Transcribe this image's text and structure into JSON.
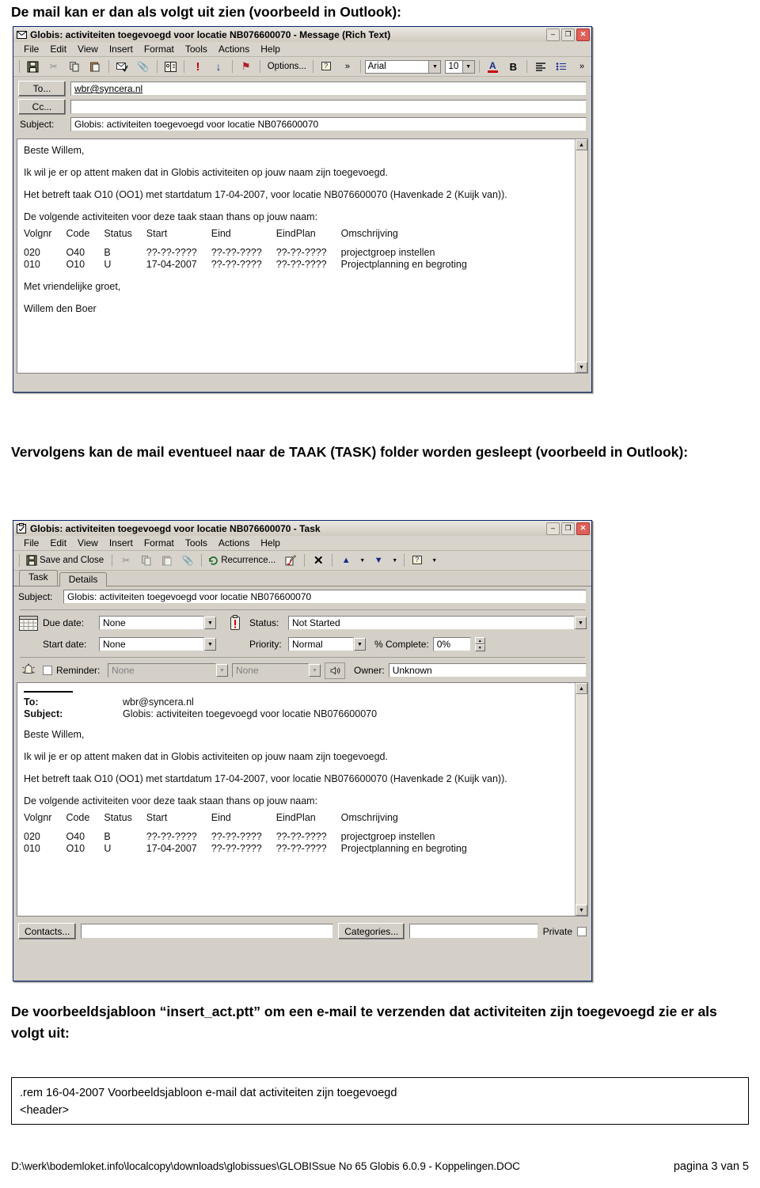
{
  "document": {
    "intro_paragraph": "De mail kan er dan als volgt uit zien (voorbeeld in Outlook):",
    "middle_paragraph": "Vervolgens kan de mail eventueel naar de TAAK (TASK) folder worden gesleept (voorbeeld in Outlook):",
    "template_paragraph": "De voorbeeldsjabloon “insert_act.ptt” om een e-mail te verzenden dat activiteiten zijn toegevoegd zie er als volgt uit:"
  },
  "template_box": {
    "line1": ".rem 16-04-2007 Voorbeeldsjabloon e-mail dat activiteiten zijn toegevoegd",
    "line2": "<header>"
  },
  "footer": {
    "path": "D:\\werk\\bodemloket.info\\localcopy\\downloads\\globissues\\GLOBISsue No 65 Globis 6.0.9 - Koppelingen.DOC",
    "page": "pagina 3 van 5"
  },
  "message_window": {
    "title": "Globis: activiteiten toegevoegd voor locatie NB076600070 - Message (Rich Text)",
    "title_icon": "envelope-icon",
    "window_buttons": {
      "minimize": "–",
      "maximize": "❐",
      "close": "✕"
    },
    "menu": [
      "File",
      "Edit",
      "View",
      "Insert",
      "Format",
      "Tools",
      "Actions",
      "Help"
    ],
    "toolbar": {
      "buttons": [
        {
          "name": "save-icon",
          "glyph": "💾"
        },
        {
          "name": "cut-icon",
          "glyph": "✂"
        },
        {
          "name": "copy-icon",
          "glyph": "⧉"
        },
        {
          "name": "paste-icon",
          "glyph": "📋"
        },
        {
          "name": "check-names-icon",
          "glyph": "✉"
        },
        {
          "name": "attach-file-icon",
          "glyph": "📎"
        },
        {
          "name": "address-book-icon",
          "glyph": "📖"
        },
        {
          "name": "high-importance-icon",
          "glyph": "!"
        },
        {
          "name": "low-importance-icon",
          "glyph": "↓"
        },
        {
          "name": "flag-icon",
          "glyph": "⚑"
        },
        {
          "name": "options-button",
          "glyph": "☰",
          "label": "Options..."
        },
        {
          "name": "help-icon",
          "glyph": "?"
        },
        {
          "name": "toolbar-overflow-icon",
          "glyph": "»"
        }
      ],
      "font_name": "Arial",
      "font_size": "10",
      "font_color_icon": "A",
      "bold_label": "B",
      "align_left_icon": "≡",
      "bullets_icon": "≔",
      "overflow_icon": "»"
    },
    "fields": {
      "to_label": "To...",
      "to_value": "wbr@syncera.nl",
      "cc_label": "Cc...",
      "cc_value": "",
      "subject_label": "Subject:",
      "subject_value": "Globis: activiteiten toegevoegd voor locatie NB076600070"
    },
    "body": {
      "greeting": "Beste Willem,",
      "line1": "Ik wil je er op attent maken dat in Globis activiteiten op jouw naam zijn toegevoegd.",
      "line2": "Het betreft taak O10 (OO1) met startdatum 17-04-2007, voor locatie NB076600070 (Havenkade 2 (Kuijk van)).",
      "line3": "De volgende activiteiten voor deze taak staan thans op jouw naam:",
      "closing": "Met vriendelijke groet,",
      "signature": "Willem den Boer",
      "table": {
        "headers": [
          "Volgnr",
          "Code",
          "Status",
          "Start",
          "Eind",
          "EindPlan",
          "Omschrijving"
        ],
        "rows": [
          [
            "020",
            "O40",
            "B",
            "??-??-????",
            "??-??-????",
            "??-??-????",
            "projectgroep instellen"
          ],
          [
            "010",
            "O10",
            "U",
            "17-04-2007",
            "??-??-????",
            "??-??-????",
            "Projectplanning en begroting"
          ]
        ]
      }
    }
  },
  "task_window": {
    "title": "Globis: activiteiten toegevoegd voor locatie NB076600070 - Task",
    "title_icon": "task-clipboard-icon",
    "window_buttons": {
      "minimize": "–",
      "maximize": "❐",
      "close": "✕"
    },
    "menu": [
      "File",
      "Edit",
      "View",
      "Insert",
      "Format",
      "Tools",
      "Actions",
      "Help"
    ],
    "toolbar": {
      "save_and_close_label": "Save and Close",
      "save_and_close_icon": "💾",
      "buttons": [
        {
          "name": "cut-icon",
          "glyph": "✂"
        },
        {
          "name": "copy-icon",
          "glyph": "⧉"
        },
        {
          "name": "paste-icon",
          "glyph": "📋"
        },
        {
          "name": "attach-file-icon",
          "glyph": "📎"
        }
      ],
      "recurrence_label": "Recurrence...",
      "recurrence_icon": "↺",
      "assign-task-icon": "✎",
      "delete_icon": "✕",
      "previous_item_icon": "▲",
      "next_item_icon": "▼",
      "help_icon": "?",
      "dropdown_arrow": "▾"
    },
    "tabs": [
      {
        "label": "Task",
        "active": true
      },
      {
        "label": "Details",
        "active": false
      }
    ],
    "form": {
      "subject_label": "Subject:",
      "subject_value": "Globis: activiteiten toegevoegd voor locatie NB076600070",
      "due_date_label": "Due date:",
      "due_date_value": "None",
      "status_label": "Status:",
      "status_value": "Not Started",
      "start_date_label": "Start date:",
      "start_date_value": "None",
      "priority_label": "Priority:",
      "priority_value": "Normal",
      "percent_complete_label": "% Complete:",
      "percent_complete_value": "0%",
      "reminder_label": "Reminder:",
      "reminder_date_value": "None",
      "reminder_time_value": "None",
      "reminder_checked": false,
      "owner_label": "Owner:",
      "owner_value": "Unknown",
      "calendar_icon": "📅",
      "status_icon": "❗",
      "bell_icon": "🔔",
      "sound_icon": "🔊"
    },
    "body": {
      "to_label": "To:",
      "to_value": "wbr@syncera.nl",
      "subject_label": "Subject:",
      "subject_value": "Globis: activiteiten toegevoegd voor locatie NB076600070",
      "greeting": "Beste Willem,",
      "line1": "Ik wil je er op attent maken dat in Globis activiteiten op jouw naam zijn toegevoegd.",
      "line2": "Het betreft taak O10 (OO1) met startdatum 17-04-2007, voor locatie NB076600070 (Havenkade 2 (Kuijk van)).",
      "line3": "De volgende activiteiten voor deze taak staan thans op jouw naam:",
      "table": {
        "headers": [
          "Volgnr",
          "Code",
          "Status",
          "Start",
          "Eind",
          "EindPlan",
          "Omschrijving"
        ],
        "rows": [
          [
            "020",
            "O40",
            "B",
            "??-??-????",
            "??-??-????",
            "??-??-????",
            "projectgroep instellen"
          ],
          [
            "010",
            "O10",
            "U",
            "17-04-2007",
            "??-??-????",
            "??-??-????",
            "Projectplanning en begroting"
          ]
        ]
      }
    },
    "bottom": {
      "contacts_label": "Contacts...",
      "contacts_value": "",
      "categories_label": "Categories...",
      "categories_value": "",
      "private_label": "Private",
      "private_checked": false
    }
  },
  "colors": {
    "window_face": "#d4d0c8",
    "title_accent": "#1663da",
    "close_red": "#e0605a",
    "field_white": "#ffffff"
  }
}
